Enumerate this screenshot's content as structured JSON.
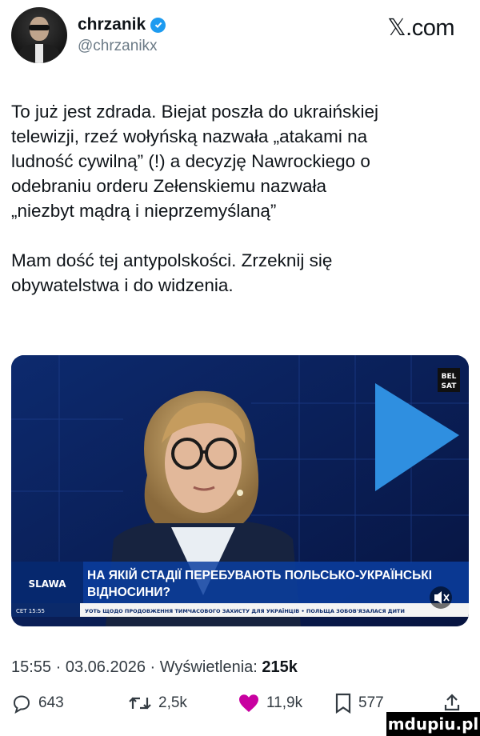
{
  "author": {
    "name": "chrzanik",
    "handle": "@chrzanikx",
    "verified": true
  },
  "site_logo": "𝕏.com",
  "tweet": {
    "paragraph1": "To już jest zdrada. Biejat poszła do ukraińskiej\ntelewizji, rzeź wołyńską nazwała „atakami na\nludność cywilną” (!) a decyzję Nawrockiego o\nodebraniu orderu Zełenskiemu nazwała\n„niezbyt mądrą i nieprzemyślaną”",
    "paragraph2": "Mam dość tej antypolskości. Zrzeknij się\nobywatelstwa i do widzenia."
  },
  "media": {
    "channel_logo": "SLAWA",
    "badge_line1": "BEL",
    "badge_line2": "SAT",
    "headline_line1": "НА ЯКІЙ СТАДІЇ ПЕРЕБУВАЮТЬ ПОЛЬСЬКО-УКРАЇНСЬКІ",
    "headline_line2": "ВІДНОСИНИ?",
    "ticker_label": "CET 15:55",
    "ticker_text": "УОТЬ ЩОДО ПРОДОВЖЕННЯ ТИМЧАСОВОГО ЗАХИСТУ ДЛЯ УКРАЇНЦІВ • ПОЛЬЩА ЗОБОВ'ЯЗАЛАСЯ ДИТИ"
  },
  "meta": {
    "time": "15:55",
    "date": "03.06.2026",
    "views_label": "Wyświetlenia:",
    "views_count": "215k"
  },
  "actions": {
    "replies": "643",
    "reposts": "2,5k",
    "likes": "11,9k",
    "bookmarks": "577"
  },
  "watermark": "mdupiu.pl",
  "colors": {
    "verified": "#1d9bf0",
    "like": "#c800a0",
    "media_bg": "#0b1f56",
    "text": "#0f1419",
    "muted": "#6b7a86"
  },
  "icons": [
    "verified-badge-icon",
    "reply-icon",
    "repost-icon",
    "heart-icon",
    "bookmark-icon",
    "share-icon",
    "mute-icon"
  ]
}
